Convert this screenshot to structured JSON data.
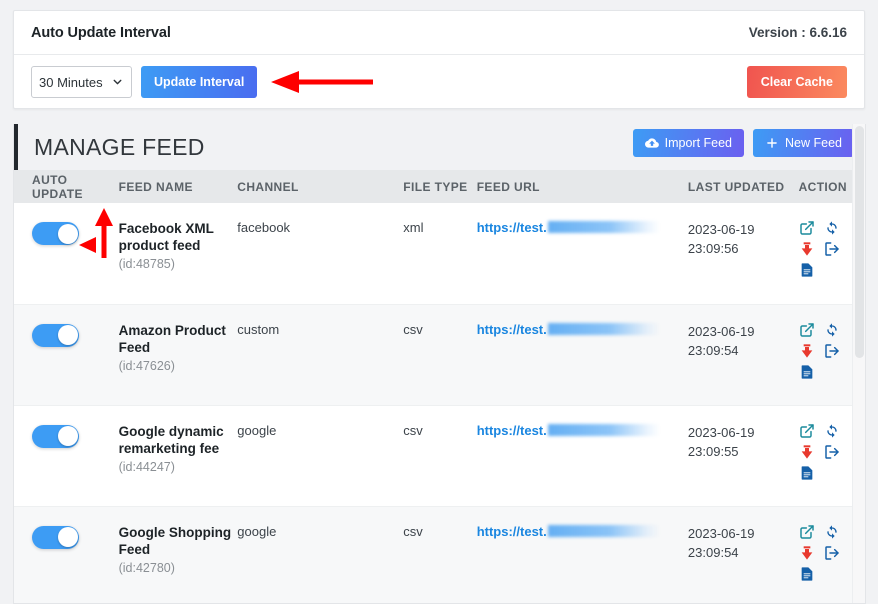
{
  "top_panel": {
    "title": "Auto Update Interval",
    "version": "Version : 6.6.16",
    "interval_select": {
      "value": "30 Minutes",
      "icon": "chevron-down-icon"
    },
    "update_button": "Update Interval",
    "clear_cache_button": "Clear Cache"
  },
  "feed_panel": {
    "heading": "MANAGE FEED",
    "import_button": "Import Feed",
    "import_icon": "cloud-upload-icon",
    "new_button": "New Feed",
    "new_icon": "plus-icon",
    "columns": [
      "AUTO UPDATE",
      "FEED NAME",
      "CHANNEL",
      "FILE TYPE",
      "FEED URL",
      "LAST UPDATED",
      "ACTION"
    ],
    "action_icons": [
      "external-link-icon",
      "refresh-icon",
      "download-icon",
      "export-icon",
      "document-icon"
    ],
    "rows": [
      {
        "auto_update": "on",
        "name": "Facebook XML product feed",
        "id": "(id:48785)",
        "channel": "facebook",
        "file_type": "xml",
        "url": "https://test.",
        "url_redacted": true,
        "last_updated_date": "2023-06-19",
        "last_updated_time": "23:09:56"
      },
      {
        "auto_update": "on",
        "name": "Amazon Product Feed",
        "id": "(id:47626)",
        "channel": "custom",
        "file_type": "csv",
        "url": "https://test.",
        "url_redacted": true,
        "last_updated_date": "2023-06-19",
        "last_updated_time": "23:09:54"
      },
      {
        "auto_update": "on",
        "name": "Google dynamic remarketing fee",
        "id": "(id:44247)",
        "channel": "google",
        "file_type": "csv",
        "url": "https://test.",
        "url_redacted": true,
        "last_updated_date": "2023-06-19",
        "last_updated_time": "23:09:55"
      },
      {
        "auto_update": "on",
        "name": "Google Shopping Feed",
        "id": "(id:42780)",
        "channel": "google",
        "file_type": "csv",
        "url": "https://test.",
        "url_redacted": true,
        "last_updated_date": "2023-06-19",
        "last_updated_time": "23:09:54"
      }
    ]
  },
  "annotations": {
    "color": "#fe0000",
    "arrow_to_update_button": "left-arrow-annotation",
    "arrow_to_toggle_up": "up-arrow-annotation",
    "arrow_to_toggle_left": "left-arrowhead-annotation"
  },
  "colors": {
    "accent_blue": "#3d9cf4",
    "purple": "#6b5ff0",
    "red": "#f0544f",
    "orange": "#fb8a5f",
    "teal": "#1a8a9c",
    "dark": "#23282d"
  }
}
